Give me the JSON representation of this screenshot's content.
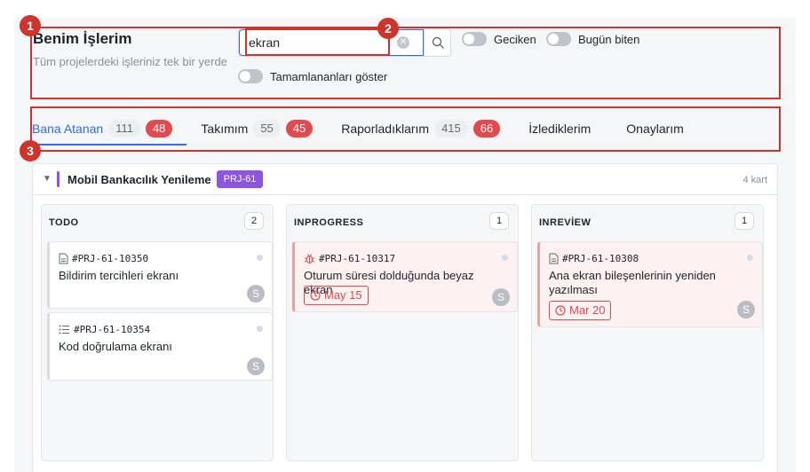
{
  "header": {
    "title": "Benim İşlerim",
    "subtitle": "Tüm projelerdeki işleriniz tek bir yerde"
  },
  "search": {
    "value": "ekran",
    "placeholder": "",
    "clear_icon": "clear-icon",
    "search_icon": "search-icon"
  },
  "toggles": [
    {
      "label": "Geciken",
      "on": false
    },
    {
      "label": "Bugün biten",
      "on": false
    },
    {
      "label": "Tamamlananları göster",
      "on": false
    }
  ],
  "annotations": [
    "1",
    "2",
    "3"
  ],
  "tabs": [
    {
      "label": "Bana Atanan",
      "count": "111",
      "badge": "48",
      "active": true
    },
    {
      "label": "Takımım",
      "count": "55",
      "badge": "45",
      "active": false
    },
    {
      "label": "Raporladıklarım",
      "count": "415",
      "badge": "66",
      "active": false
    },
    {
      "label": "İzlediklerim",
      "active": false
    },
    {
      "label": "Onaylarım",
      "active": false
    }
  ],
  "group": {
    "name": "Mobil Bankacılık Yenileme",
    "tag": "PRJ-61",
    "card_count": "4 kart",
    "color": "#8c55e0"
  },
  "columns": [
    {
      "title": "TODO",
      "count": "2",
      "cards": [
        {
          "id": "#PRJ-61-10350",
          "icon": "document-icon",
          "title": "Bildirim tercihleri ekranı",
          "avatar": "S"
        },
        {
          "id": "#PRJ-61-10354",
          "icon": "list-icon",
          "title": "Kod doğrulama ekranı",
          "avatar": "S"
        }
      ]
    },
    {
      "title": "INPROGRESS",
      "count": "1",
      "cards": [
        {
          "id": "#PRJ-61-10317",
          "icon": "bug-icon",
          "title": "Oturum süresi dolduğunda beyaz ekran",
          "due": "May 15",
          "avatar": "S"
        }
      ]
    },
    {
      "title": "INREVİEW",
      "count": "1",
      "cards": [
        {
          "id": "#PRJ-61-10308",
          "icon": "document-icon",
          "title": "Ana ekran bileşenlerinin yeniden yazılması",
          "due": "Mar 20",
          "avatar": "S"
        }
      ]
    }
  ],
  "colors": {
    "accent": "#2e6be6",
    "danger": "#e5484d",
    "annotation": "#d0332b"
  }
}
